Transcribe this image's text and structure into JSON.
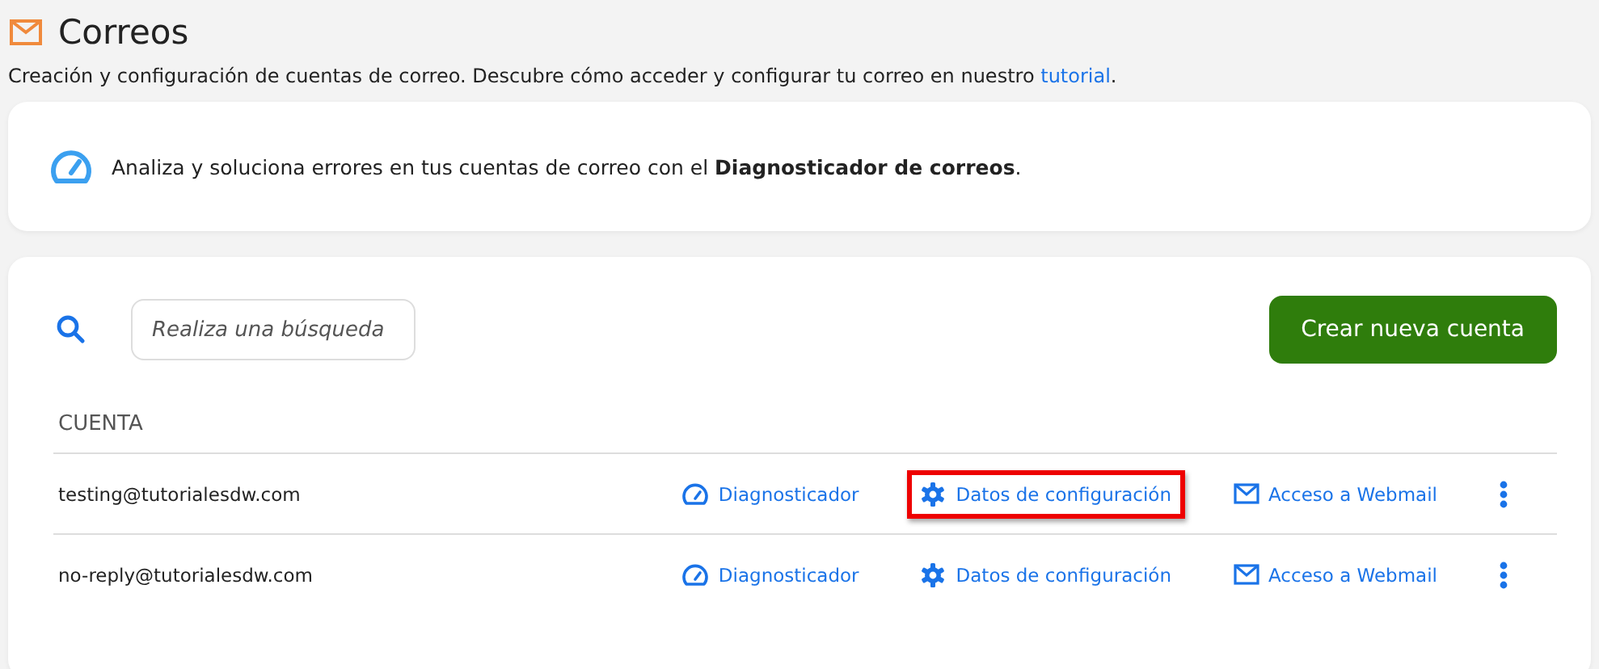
{
  "page": {
    "title": "Correos",
    "intro": "Creación y configuración de cuentas de correo. Descubre cómo acceder y configurar tu correo en nuestro",
    "intro_link": "tutorial",
    "intro_end": "."
  },
  "notice": {
    "text": "Analiza y soluciona errores en tus cuentas de correo con el **Diagnosticador de correos**."
  },
  "search": {
    "placeholder": "Realiza una búsqueda"
  },
  "create_button": "Crear nueva cuenta",
  "table": {
    "columns": [
      "CUENTA"
    ],
    "rows": [
      {
        "account": "testing@tutorialesdw.com",
        "actions": [
          {
            "kind": "diagnose",
            "label": "Diagnosticador",
            "highlighted": false
          },
          {
            "kind": "settings",
            "label": "Datos de configuración",
            "highlighted": true
          },
          {
            "kind": "webmail",
            "label": "Acceso a Webmail",
            "highlighted": false
          }
        ]
      },
      {
        "account": "no-reply@tutorialesdw.com",
        "actions": [
          {
            "kind": "diagnose",
            "label": "Diagnosticador",
            "highlighted": false
          },
          {
            "kind": "settings",
            "label": "Datos de configuración",
            "highlighted": false
          },
          {
            "kind": "webmail",
            "label": "Acceso a Webmail",
            "highlighted": false
          }
        ]
      }
    ]
  }
}
